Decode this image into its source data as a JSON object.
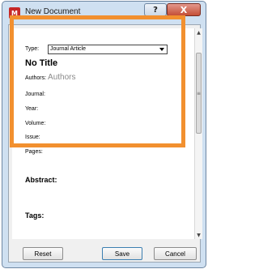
{
  "window": {
    "title": "New Document",
    "app_icon_glyph": "M",
    "help_glyph": "?",
    "close_glyph": "X"
  },
  "form": {
    "type_label": "Type:",
    "type_value": "Journal Article",
    "doc_title": "No Title",
    "authors_label": "Authors:",
    "authors_placeholder": "Authors",
    "journal_label": "Journal:",
    "year_label": "Year:",
    "volume_label": "Volume:",
    "issue_label": "Issue:",
    "pages_label": "Pages:",
    "abstract_label": "Abstract:",
    "tags_label": "Tags:"
  },
  "buttons": {
    "reset": "Reset",
    "save": "Save",
    "cancel": "Cancel"
  },
  "colors": {
    "highlight": "#f2902f",
    "app_icon": "#c62828",
    "close_button": "#c44f37"
  }
}
